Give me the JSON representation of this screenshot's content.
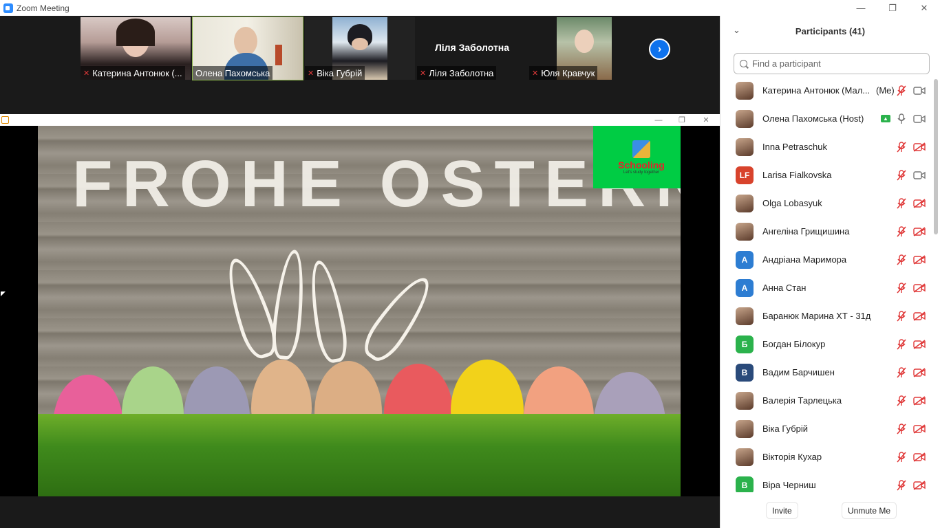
{
  "window": {
    "title": "Zoom Meeting",
    "controls": {
      "minimize": "—",
      "restore": "❐",
      "close": "✕"
    }
  },
  "gallery": {
    "tiles": [
      {
        "name": "Катерина Антонюк (...",
        "muted": true,
        "video": true,
        "active": false
      },
      {
        "name": "Олена Пахомська",
        "muted": false,
        "video": true,
        "active": true
      },
      {
        "name": "Віка Губрій",
        "muted": true,
        "video": true,
        "active": false
      },
      {
        "name": "Ліля Заболотна",
        "center_name": "Ліля Заболотна",
        "muted": true,
        "video": false,
        "active": false
      },
      {
        "name": "Юля Кравчук",
        "muted": true,
        "video": true,
        "active": false
      }
    ],
    "next_icon": "chevron-right-icon"
  },
  "share": {
    "slide_headline": "FROHE OSTERN.",
    "logo": {
      "brand": "Schooling",
      "tagline": "Let's study together"
    },
    "window_controls": {
      "minimize": "—",
      "restore": "❐",
      "close": "✕"
    }
  },
  "participants": {
    "title": "Participants (41)",
    "search_placeholder": "Find a participant",
    "list": [
      {
        "name": "Катерина Антонюк (Мал...",
        "tag": "(Me)",
        "avatar": "photo",
        "mic": "muted",
        "cam": "on"
      },
      {
        "name": "Олена Пахомська (Host)",
        "tag": "",
        "avatar": "photo",
        "sharing": true,
        "mic": "on",
        "cam": "on"
      },
      {
        "name": "Inna Petraschuk",
        "tag": "",
        "avatar": "photo",
        "mic": "muted",
        "cam": "off"
      },
      {
        "name": "Larisa Fialkovska",
        "tag": "",
        "avatar": "LF",
        "avatar_color": "#d8432c",
        "mic": "muted",
        "cam": "on"
      },
      {
        "name": "Olga Lobasyuk",
        "tag": "",
        "avatar": "photo",
        "mic": "muted",
        "cam": "off"
      },
      {
        "name": "Ангеліна Грищишина",
        "tag": "",
        "avatar": "photo",
        "mic": "muted",
        "cam": "off"
      },
      {
        "name": "Андріана Маримора",
        "tag": "",
        "avatar": "A",
        "avatar_color": "#2d7dd2",
        "mic": "muted",
        "cam": "off"
      },
      {
        "name": "Анна Стан",
        "tag": "",
        "avatar": "A",
        "avatar_color": "#2d7dd2",
        "mic": "muted",
        "cam": "off"
      },
      {
        "name": "Баранюк Марина ХТ - 31д",
        "tag": "",
        "avatar": "photo",
        "mic": "muted",
        "cam": "off"
      },
      {
        "name": "Богдан Білокур",
        "tag": "",
        "avatar": "Б",
        "avatar_color": "#2bb24c",
        "mic": "muted",
        "cam": "off"
      },
      {
        "name": "Вадим Барчишен",
        "tag": "",
        "avatar": "В",
        "avatar_color": "#2a4a7a",
        "mic": "muted",
        "cam": "off"
      },
      {
        "name": "Валерія Тарлецька",
        "tag": "",
        "avatar": "photo",
        "mic": "muted",
        "cam": "off"
      },
      {
        "name": "Віка Губрій",
        "tag": "",
        "avatar": "photo",
        "mic": "muted",
        "cam": "off"
      },
      {
        "name": "Вікторія Кухар",
        "tag": "",
        "avatar": "photo",
        "mic": "muted",
        "cam": "off"
      },
      {
        "name": "Віра Черниш",
        "tag": "",
        "avatar": "В",
        "avatar_color": "#2bb24c",
        "mic": "muted",
        "cam": "off"
      }
    ],
    "footer": {
      "invite": "Invite",
      "unmute": "Unmute Me"
    }
  },
  "colors": {
    "accent_blue": "#0e72ed",
    "muted_red": "#e03a3a",
    "active_tile_border": "#8ab34a",
    "share_green": "#2bb24c"
  }
}
